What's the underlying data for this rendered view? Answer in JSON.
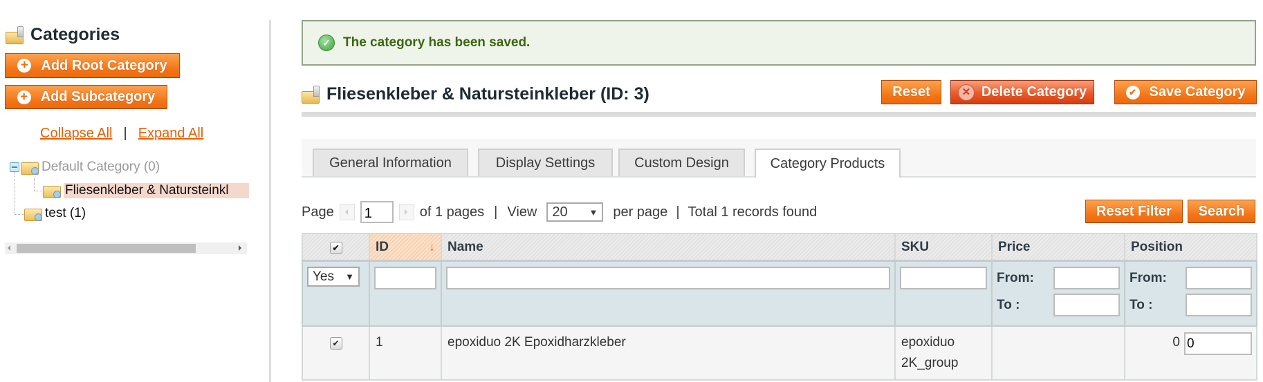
{
  "sidebar": {
    "title": "Categories",
    "add_root_label": "Add Root Category",
    "add_sub_label": "Add Subcategory",
    "collapse_all": "Collapse All",
    "separator": "|",
    "expand_all": "Expand All",
    "tree": [
      {
        "label": "Default Category (0)",
        "level": 0,
        "expanded": true,
        "disabled": true
      },
      {
        "label": "Fliesenkleber & Natursteinkl",
        "level": 1,
        "selected": true
      },
      {
        "label": "test (1)",
        "level": 0
      }
    ]
  },
  "message": {
    "text": "The category has been saved.",
    "type": "success"
  },
  "header": {
    "title": "Fliesenkleber & Natursteinkleber (ID: 3)",
    "reset_label": "Reset",
    "delete_label": "Delete Category",
    "save_label": "Save Category"
  },
  "tabs": [
    {
      "label": "General Information",
      "active": false
    },
    {
      "label": "Display Settings",
      "active": false
    },
    {
      "label": "Custom Design",
      "active": false
    },
    {
      "label": "Category Products",
      "active": true
    }
  ],
  "pager": {
    "page_label": "Page",
    "page_value": "1",
    "of_pages": "of 1 pages",
    "sep": "|",
    "view_label": "View",
    "per_page_value": "20",
    "per_page_label": "per page",
    "total": "Total 1 records found",
    "reset_filter_label": "Reset Filter",
    "search_label": "Search"
  },
  "grid": {
    "columns": [
      "",
      "ID",
      "Name",
      "SKU",
      "Price",
      "Position"
    ],
    "filter": {
      "in_category": "Yes",
      "from_label": "From:",
      "to_label": "To :"
    },
    "rows": [
      {
        "checked": true,
        "id": "1",
        "name": "epoxiduo 2K Epoxidharzkleber",
        "sku_line1": "epoxiduo",
        "sku_line2": "2K_group",
        "price": "",
        "position_text": "0",
        "position_input": "0"
      }
    ]
  }
}
